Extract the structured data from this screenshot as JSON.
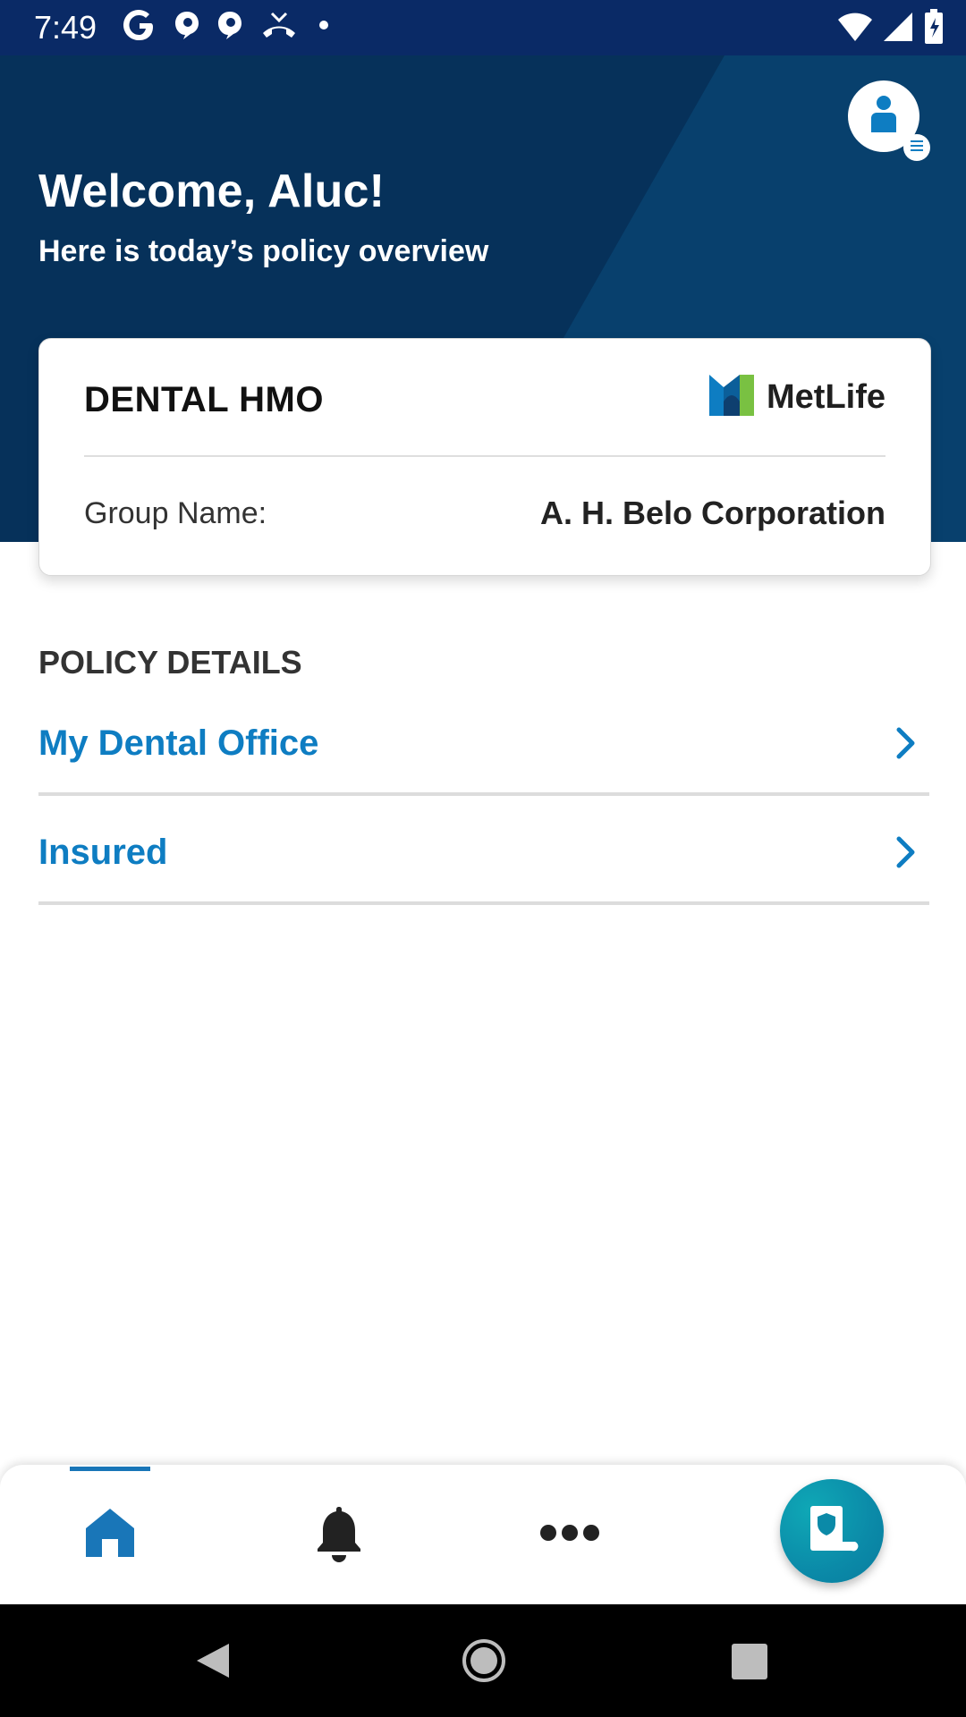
{
  "status_bar": {
    "time": "7:49",
    "icons_left": [
      "google-icon",
      "chat-icon",
      "chat-icon",
      "missed-call-icon",
      "dot-icon"
    ],
    "icons_right": [
      "wifi-icon",
      "signal-icon",
      "battery-icon"
    ]
  },
  "header": {
    "title": "Welcome, Aluc!",
    "subtitle": "Here is today’s policy overview",
    "background_color": "#06315a"
  },
  "policy_card": {
    "plan_name": "DENTAL HMO",
    "brand": "MetLife",
    "group_label": "Group Name:",
    "group_value": "A. H. Belo Corporation"
  },
  "policy_details": {
    "section_title": "POLICY DETAILS",
    "items": [
      {
        "label": "My Dental Office"
      },
      {
        "label": "Insured"
      }
    ]
  },
  "bottom_nav": {
    "items": [
      {
        "name": "home",
        "icon": "home-icon",
        "active": true
      },
      {
        "name": "notifications",
        "icon": "bell-icon",
        "active": false
      },
      {
        "name": "more",
        "icon": "more-icon",
        "active": false
      }
    ],
    "fab_icon": "id-card-shield-icon",
    "accent_color": "#1976b8"
  },
  "colors": {
    "link_blue": "#0e7dc2",
    "header_navy": "#06315a",
    "status_bar": "#0a2a66"
  }
}
